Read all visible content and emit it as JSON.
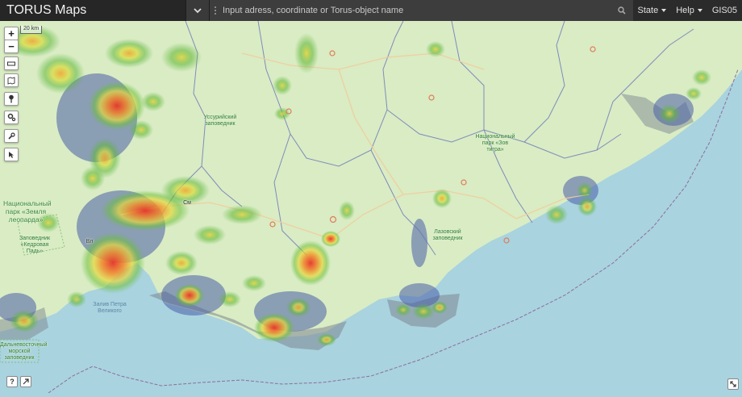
{
  "app": {
    "title": "TORUS Maps"
  },
  "search": {
    "placeholder": "Input adress, coordinate or Torus-object name"
  },
  "menu": {
    "state_label": "State",
    "help_label": "Help",
    "user_label": "GIS05"
  },
  "map": {
    "scale_label": "20 km",
    "labels": {
      "ussuri_reserve": "Уссурийский заповедник",
      "national_park_tiger": "Национальный парк «Зов тигра»",
      "national_park_leopard": "Национальный парк «Земля леопарда»",
      "lazovsky_reserve": "Лазовский заповедник",
      "kedrovaya_reserve": "Заповедник «Кедровая Падь»",
      "gulf": "Залив Петра Великого",
      "marine_reserve": "Дальневосточный морской заповедник",
      "vladivostok": "Вл",
      "city_sm": "См"
    }
  },
  "controls": {
    "help_label": "?"
  },
  "colors": {
    "land": "#d9ecc4",
    "sea": "#a9d3df",
    "coverage_low": "#4a5fa8",
    "coverage_mid": "#6bbf3a",
    "coverage_high": "#e8342a",
    "boundary": "#6a73b8",
    "road": "#f6d5a4",
    "topbar": "#2b2b2b"
  }
}
